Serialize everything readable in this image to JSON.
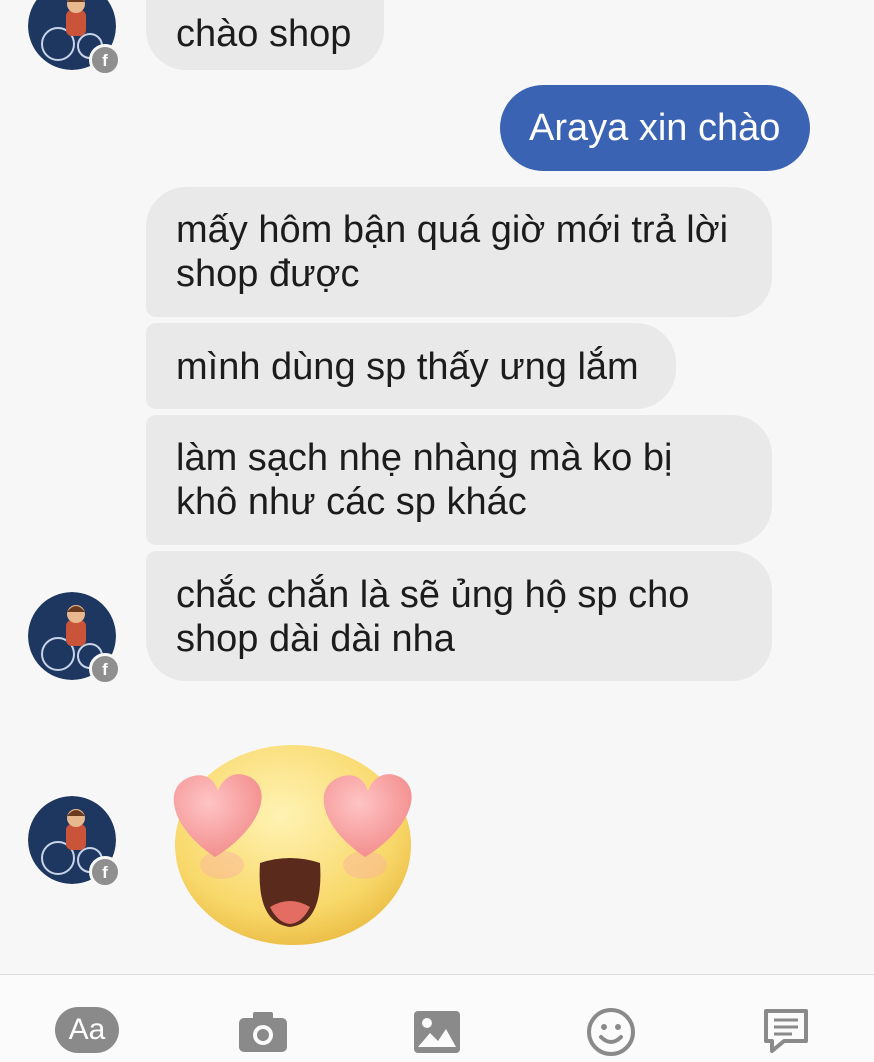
{
  "chat": {
    "messages": [
      {
        "sender": "customer",
        "text": "chào shop"
      },
      {
        "sender": "shop",
        "text": "Araya xin chào"
      },
      {
        "sender": "customer",
        "text": "mấy hôm bận quá giờ mới trả lời shop được"
      },
      {
        "sender": "customer",
        "text": "mình dùng sp thấy ưng lắm"
      },
      {
        "sender": "customer",
        "text": "làm sạch nhẹ nhàng mà ko bị khô như các sp khác"
      },
      {
        "sender": "customer",
        "text": "chắc chắn là sẽ ủng hộ sp cho shop dài dài nha"
      },
      {
        "sender": "customer",
        "sticker": "heart-eyes-emoji"
      }
    ]
  },
  "composer": {
    "text_button_label": "Aa",
    "icons": [
      "text-input-icon",
      "camera-icon",
      "gallery-icon",
      "emoji-icon",
      "quick-replies-icon"
    ]
  },
  "colors": {
    "outgoing_bubble": "#3a63b3",
    "incoming_bubble": "#e9e9e9",
    "background": "#f7f7f7",
    "icon_gray": "#8a8a8a"
  }
}
